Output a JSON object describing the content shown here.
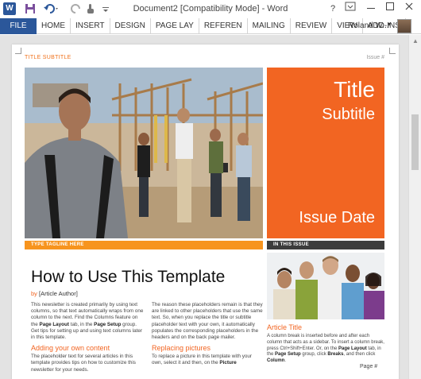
{
  "window": {
    "title": "Document2 [Compatibility Mode] - Word",
    "qat": {
      "word_icon_label": "W"
    }
  },
  "ribbon": {
    "file_tab": "FILE",
    "tabs": [
      "HOME",
      "INSERT",
      "DESIGN",
      "PAGE LAY",
      "REFEREN",
      "MAILING",
      "REVIEW",
      "VIEW",
      "ADD-INS"
    ],
    "user_name": "Roland W..."
  },
  "document": {
    "header": {
      "title_subtitle": "TITLE SUBTITLE",
      "issue": "Issue #"
    },
    "masthead": {
      "title": "Title",
      "subtitle": "Subtitle",
      "issue_date": "Issue Date"
    },
    "tagline": "TYPE TAGLINE HERE",
    "in_this_issue": "IN THIS ISSUE",
    "main_heading": "How to Use This Template",
    "byline_by": "by",
    "byline_author": "[Article Author]",
    "col1": {
      "p1_a": "This newsletter is created primarily by using text columns, so that text automatically wraps from one column to the next. Find the Columns feature on the ",
      "p1_b": "Page Layout",
      "p1_c": " tab, in the ",
      "p1_d": "Page Setup",
      "p1_e": " group. Get tips for setting up and using text columns later in this template.",
      "h2": "Adding your own content",
      "p2": "The placeholder text for several articles in this template provides tips on how to customize this newsletter for your needs."
    },
    "col2": {
      "p1": "The reason these placeholders remain is that they are linked to other placeholders that use the same text. So, when you replace the title or subtitle placeholder text with your own, it automatically populates the corresponding placeholders in the headers and on the back page mailer.",
      "h2": "Replacing pictures",
      "p2_a": "To replace a picture in this template with your own, select it and then, on the ",
      "p2_b": "Picture"
    },
    "sidebar": {
      "heading": "Article Title",
      "text_a": "A column break is inserted before and after each column that acts as a sidebar. To insert a column break, press Ctrl+Shift+Enter. Or, on the ",
      "text_b": "Page Layout",
      "text_c": " tab, in the ",
      "text_d": "Page Setup",
      "text_e": " group, click ",
      "text_f": "Breaks",
      "text_g": ", and then click ",
      "text_h": "Column",
      "text_i": "."
    },
    "page_number": "Page #"
  },
  "colors": {
    "accent_orange": "#f26522",
    "tagline_orange": "#f7941e",
    "word_blue": "#2b579a",
    "dark_bar": "#3c3c3c"
  }
}
